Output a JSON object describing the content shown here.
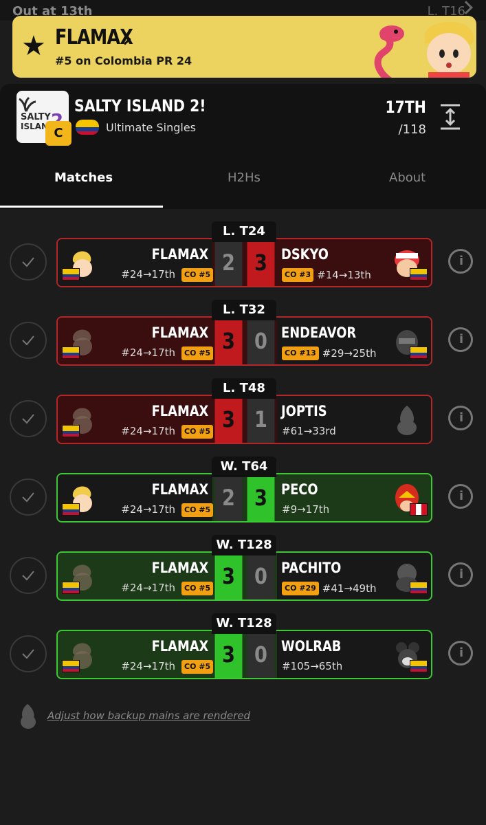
{
  "peek": {
    "left_text": "Out at 13th",
    "right_text": "L. T16"
  },
  "banner": {
    "player": "FLAMAX",
    "rank": "#5 on Colombia PR 24",
    "star_icon": "star-icon",
    "color": "#ecd35f"
  },
  "tournament": {
    "name": "SALTY ISLAND 2!",
    "logo_text_1": "SALTY",
    "logo_text_2": "ISLAND",
    "logo_num": "2",
    "tier": "C",
    "event": "Ultimate Singles",
    "placing": "17TH",
    "entrants": "/118"
  },
  "tabs": [
    {
      "label": "Matches"
    },
    {
      "label": "H2Hs"
    },
    {
      "label": "About"
    }
  ],
  "matches": [
    {
      "round": "L. T24",
      "left_name": "FLAMAX",
      "left_seed": "#24→17th",
      "left_badge": "CO #5",
      "left_score": "2",
      "right_score": "3",
      "right_name": "DSKYO",
      "right_badge": "CO #3",
      "right_seed": "#14→13th"
    },
    {
      "round": "L. T32",
      "left_name": "FLAMAX",
      "left_seed": "#24→17th",
      "left_badge": "CO #5",
      "left_score": "3",
      "right_score": "0",
      "right_name": "ENDEAVOR",
      "right_badge": "CO #13",
      "right_seed": "#29→25th"
    },
    {
      "round": "L. T48",
      "left_name": "FLAMAX",
      "left_seed": "#24→17th",
      "left_badge": "CO #5",
      "left_score": "3",
      "right_score": "1",
      "right_name": "JOPTIS",
      "right_badge": "",
      "right_seed": "#61→33rd"
    },
    {
      "round": "W. T64",
      "left_name": "FLAMAX",
      "left_seed": "#24→17th",
      "left_badge": "CO #5",
      "left_score": "2",
      "right_score": "3",
      "right_name": "PECO",
      "right_badge": "",
      "right_seed": "#9→17th"
    },
    {
      "round": "W. T128",
      "left_name": "FLAMAX",
      "left_seed": "#24→17th",
      "left_badge": "CO #5",
      "left_score": "3",
      "right_score": "0",
      "right_name": "PACHITO",
      "right_badge": "CO #29",
      "right_seed": "#41→49th"
    },
    {
      "round": "W. T128",
      "left_name": "FLAMAX",
      "left_seed": "#24→17th",
      "left_badge": "CO #5",
      "left_score": "3",
      "right_score": "0",
      "right_name": "WOLRAB",
      "right_badge": "",
      "right_seed": "#105→65th"
    }
  ],
  "footer": {
    "link": "Adjust how backup mains are rendered"
  },
  "colors": {
    "loss_red": "#c0191e",
    "win_green": "#2fc22a",
    "badge_orange": "#f2a012",
    "tier_gold": "#f2b51a"
  }
}
